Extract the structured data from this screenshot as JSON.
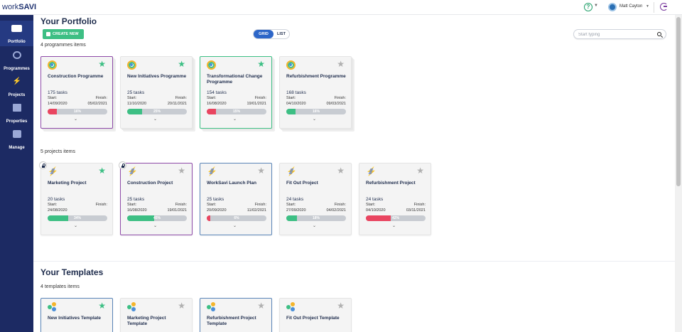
{
  "app": {
    "logo_light": "work",
    "logo_bold": "SAVI",
    "user_name": "Matt Cayton",
    "help_glyph": "?"
  },
  "colors": {
    "sidebar": "#1c2a63",
    "accent_green": "#3dbf84",
    "accent_blue": "#2d66c8",
    "progress_red": "#e94560",
    "progress_green": "#3dbf84"
  },
  "sidebar": {
    "items": [
      {
        "label": "Portfolio",
        "icon": "portfolio-icon",
        "active": true
      },
      {
        "label": "Programmes",
        "icon": "programmes-icon"
      },
      {
        "label": "Projects",
        "icon": "projects-icon"
      },
      {
        "label": "Properties",
        "icon": "properties-icon"
      },
      {
        "label": "Manage",
        "icon": "manage-icon"
      }
    ]
  },
  "header": {
    "title": "Your Portfolio",
    "create_label": "CREATE NEW",
    "view_grid": "GRID",
    "view_list": "LIST",
    "search_placeholder": "Start typing"
  },
  "programmes": {
    "count_label": "4 programmes items",
    "items": [
      {
        "name": "Construction Programme",
        "tasks": "175 tasks",
        "start": "14/09/2020",
        "finish": "05/02/2021",
        "pct": "16%",
        "progress": 0.16,
        "color": "#e94560",
        "starred": true,
        "border": "purple"
      },
      {
        "name": "New Initiatives Programme",
        "tasks": "25 tasks",
        "start": "11/10/2020",
        "finish": "20/11/2021",
        "pct": "25%",
        "progress": 0.25,
        "color": "#3dbf84",
        "starred": true,
        "border": ""
      },
      {
        "name": "Transformational Change Programme",
        "tasks": "154 tasks",
        "start": "16/08/2020",
        "finish": "19/01/2021",
        "pct": "15%",
        "progress": 0.15,
        "color": "#e94560",
        "starred": true,
        "border": "green"
      },
      {
        "name": "Refurbishment Programme",
        "tasks": "168 tasks",
        "start": "04/10/2020",
        "finish": "09/03/2021",
        "pct": "16%",
        "progress": 0.16,
        "color": "#3dbf84",
        "starred": false,
        "border": ""
      }
    ]
  },
  "projects": {
    "count_label": "5 projects items",
    "items": [
      {
        "name": "Marketing Project",
        "tasks": "20 tasks",
        "start": "24/08/2020",
        "finish": "",
        "pct": "34%",
        "progress": 0.34,
        "color": "#3dbf84",
        "starred": true,
        "locked": true,
        "border": ""
      },
      {
        "name": "Construction Project",
        "tasks": "25 tasks",
        "start": "16/08/2020",
        "finish": "19/01/2021",
        "pct": "45%",
        "progress": 0.45,
        "color": "#3dbf84",
        "starred": false,
        "locked": true,
        "border": "purple"
      },
      {
        "name": "WorkSavi Launch Plan",
        "tasks": "25 tasks",
        "start": "20/09/2020",
        "finish": "11/02/2021",
        "pct": "6%",
        "progress": 0.06,
        "color": "#e94560",
        "starred": false,
        "locked": false,
        "border": "blue"
      },
      {
        "name": "Fit Out Project",
        "tasks": "24 tasks",
        "start": "27/09/2020",
        "finish": "04/02/2021",
        "pct": "18%",
        "progress": 0.18,
        "color": "#3dbf84",
        "starred": false,
        "locked": false,
        "border": ""
      },
      {
        "name": "Refurbishment Project",
        "tasks": "24 tasks",
        "start": "04/10/2020",
        "finish": "03/11/2021",
        "pct": "42%",
        "progress": 0.42,
        "color": "#e94560",
        "starred": false,
        "locked": false,
        "border": ""
      }
    ]
  },
  "templates": {
    "title": "Your Templates",
    "count_label": "4 templates items",
    "items": [
      {
        "name": "New Initiatives Template",
        "starred": true,
        "border": "blue"
      },
      {
        "name": "Marketing Project Template",
        "starred": false,
        "border": ""
      },
      {
        "name": "Refurbishment Project Template",
        "starred": false,
        "border": "blue"
      },
      {
        "name": "Fit Out Project Template",
        "starred": false,
        "border": ""
      }
    ]
  },
  "labels": {
    "start": "Start:",
    "finish": "Finish:",
    "star_glyph": "★",
    "chevron_glyph": "⌄"
  }
}
